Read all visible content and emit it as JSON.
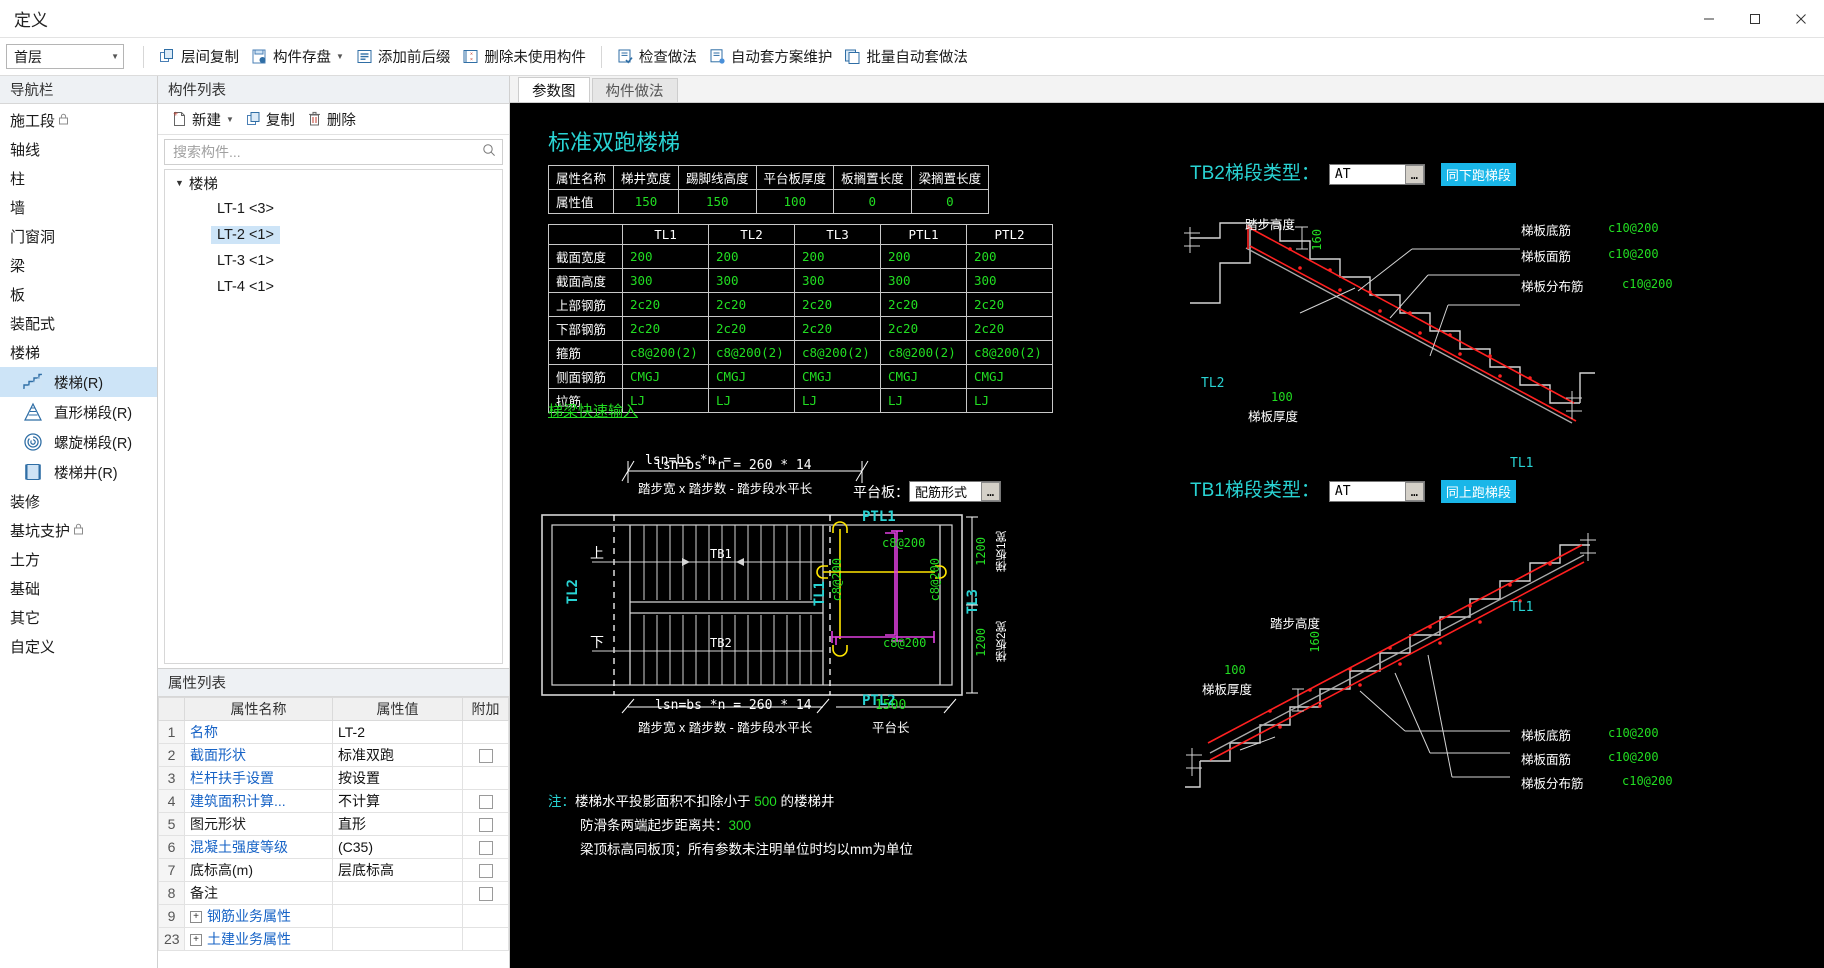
{
  "window": {
    "title": "定义",
    "minimize": "−",
    "maximize": "▢",
    "close": "✕"
  },
  "toolbar": {
    "floor_select": "首层",
    "buttons": [
      {
        "label": "层间复制",
        "icon": "copy-between-floors-icon",
        "dropdown": false
      },
      {
        "label": "构件存盘",
        "icon": "save-component-icon",
        "dropdown": true
      },
      {
        "label": "添加前后缀",
        "icon": "add-affix-icon",
        "dropdown": false
      },
      {
        "label": "删除未使用构件",
        "icon": "delete-unused-icon",
        "dropdown": false
      },
      {
        "label": "检查做法",
        "icon": "check-method-icon",
        "dropdown": false
      },
      {
        "label": "自动套方案维护",
        "icon": "auto-scheme-icon",
        "dropdown": false
      },
      {
        "label": "批量自动套做法",
        "icon": "batch-auto-icon",
        "dropdown": false
      }
    ]
  },
  "nav": {
    "title": "导航栏",
    "items": [
      {
        "label": "施工段",
        "locked": true
      },
      {
        "label": "轴线",
        "locked": false
      },
      {
        "label": "柱",
        "locked": false
      },
      {
        "label": "墙",
        "locked": false
      },
      {
        "label": "门窗洞",
        "locked": false
      },
      {
        "label": "梁",
        "locked": false
      },
      {
        "label": "板",
        "locked": false
      },
      {
        "label": "装配式",
        "locked": false
      },
      {
        "label": "楼梯",
        "locked": false
      }
    ],
    "sub_items": [
      {
        "label": "楼梯(R)",
        "icon": "stair-icon",
        "selected": true
      },
      {
        "label": "直形梯段(R)",
        "icon": "straight-flight-icon",
        "selected": false
      },
      {
        "label": "螺旋梯段(R)",
        "icon": "spiral-flight-icon",
        "selected": false
      },
      {
        "label": "楼梯井(R)",
        "icon": "stairwell-icon",
        "selected": false
      }
    ],
    "items_after": [
      {
        "label": "装修",
        "locked": false
      },
      {
        "label": "基坑支护",
        "locked": true
      },
      {
        "label": "土方",
        "locked": false
      },
      {
        "label": "基础",
        "locked": false
      },
      {
        "label": "其它",
        "locked": false
      },
      {
        "label": "自定义",
        "locked": false
      }
    ]
  },
  "component_panel": {
    "title": "构件列表",
    "tools": [
      {
        "label": "新建",
        "icon": "new-file-icon",
        "dropdown": true
      },
      {
        "label": "复制",
        "icon": "copy-icon",
        "dropdown": false
      },
      {
        "label": "删除",
        "icon": "trash-icon",
        "dropdown": false
      }
    ],
    "search_placeholder": "搜索构件...",
    "search_value": "",
    "tree_root": "楼梯",
    "tree_items": [
      {
        "label": "LT-1 <3>",
        "selected": false
      },
      {
        "label": "LT-2 <1>",
        "selected": true
      },
      {
        "label": "LT-3 <1>",
        "selected": false
      },
      {
        "label": "LT-4 <1>",
        "selected": false
      }
    ]
  },
  "properties": {
    "title": "属性列表",
    "columns": [
      "",
      "属性名称",
      "属性值",
      "附加"
    ],
    "rows": [
      {
        "idx": "1",
        "name": "名称",
        "value": "LT-2",
        "link": true,
        "checkbox": false,
        "expander": null
      },
      {
        "idx": "2",
        "name": "截面形状",
        "value": "标准双跑",
        "link": true,
        "checkbox": true,
        "expander": null
      },
      {
        "idx": "3",
        "name": "栏杆扶手设置",
        "value": "按设置",
        "link": true,
        "checkbox": false,
        "expander": null
      },
      {
        "idx": "4",
        "name": "建筑面积计算...",
        "value": "不计算",
        "link": true,
        "checkbox": true,
        "expander": null
      },
      {
        "idx": "5",
        "name": "图元形状",
        "value": "直形",
        "link": false,
        "checkbox": true,
        "expander": null
      },
      {
        "idx": "6",
        "name": "混凝土强度等级",
        "value": "(C35)",
        "link": true,
        "checkbox": true,
        "expander": null
      },
      {
        "idx": "7",
        "name": "底标高(m)",
        "value": "层底标高",
        "link": false,
        "checkbox": true,
        "expander": null
      },
      {
        "idx": "8",
        "name": "备注",
        "value": "",
        "link": false,
        "checkbox": true,
        "expander": null
      },
      {
        "idx": "9",
        "name": "钢筋业务属性",
        "value": "",
        "link": true,
        "checkbox": false,
        "expander": "+"
      },
      {
        "idx": "23",
        "name": "土建业务属性",
        "value": "",
        "link": true,
        "checkbox": false,
        "expander": "+"
      }
    ]
  },
  "main": {
    "tabs": [
      {
        "label": "参数图",
        "active": true
      },
      {
        "label": "构件做法",
        "active": false
      }
    ]
  },
  "diagram": {
    "title": "标准双跑楼梯",
    "quick_input_link": "梯梁快速输入",
    "table1": {
      "header_cell": "属性名称",
      "row_label": "属性值",
      "columns": [
        "梯井宽度",
        "踢脚线高度",
        "平台板厚度",
        "板搁置长度",
        "梁搁置长度"
      ],
      "values": [
        "150",
        "150",
        "100",
        "0",
        "0"
      ]
    },
    "table2": {
      "columns": [
        "TL1",
        "TL2",
        "TL3",
        "PTL1",
        "PTL2"
      ],
      "rows": [
        {
          "label": "截面宽度",
          "values": [
            "200",
            "200",
            "200",
            "200",
            "200"
          ]
        },
        {
          "label": "截面高度",
          "values": [
            "300",
            "300",
            "300",
            "300",
            "300"
          ]
        },
        {
          "label": "上部钢筋",
          "values": [
            "2c20",
            "2c20",
            "2c20",
            "2c20",
            "2c20"
          ]
        },
        {
          "label": "下部钢筋",
          "values": [
            "2c20",
            "2c20",
            "2c20",
            "2c20",
            "2c20"
          ]
        },
        {
          "label": "箍筋",
          "values": [
            "c8@200(2)",
            "c8@200(2)",
            "c8@200(2)",
            "c8@200(2)",
            "c8@200(2)"
          ]
        },
        {
          "label": "侧面钢筋",
          "values": [
            "CMGJ",
            "CMGJ",
            "CMGJ",
            "CMGJ",
            "CMGJ"
          ]
        },
        {
          "label": "拉筋",
          "values": [
            "LJ",
            "LJ",
            "LJ",
            "LJ",
            "LJ"
          ]
        }
      ]
    },
    "plan": {
      "top_dim_value": "lsn=bs *n = 260 * 14",
      "top_dim_caption": "踏步宽 x 踏步数 - 踏步段水平长",
      "bottom_dim_value": "lsn=bs *n = 260 * 14",
      "bottom_dim_caption": "踏步宽 x 踏步数 - 踏步段水平长",
      "platform_width": "1500",
      "platform_caption": "平台长",
      "slab_label": "平台板：",
      "slab_field": "配筋形式",
      "slab_ellipsis": "…",
      "up_label": "上",
      "down_label": "下",
      "flight_top": "TB1",
      "flight_bottom": "TB2",
      "beam_left": "TL2",
      "beam_mid": "TL1",
      "beam_right": "TL3",
      "beam_ptl1": "PTL1",
      "beam_ptl2": "PTL2",
      "rebar_top": "c8@200",
      "rebar_left": "c8@200",
      "rebar_right": "c8@200",
      "rebar_bottom": "c8@200",
      "dim_1200_a": "1200",
      "dim_1200_b": "1200",
      "side_label_a": "梯板1宽",
      "side_label_b": "梯板2宽"
    },
    "section_tb2": {
      "label": "TB2梯段类型：",
      "type_value": "AT",
      "ellipsis": "…",
      "badge": "同下跑梯段",
      "beam_label": "TL2",
      "end_beam_label": "TL1",
      "step_height_caption": "踏步高度",
      "step_height_value": "160",
      "slab_thickness_value": "100",
      "slab_thickness_caption": "梯板厚度",
      "callouts": [
        {
          "label": "梯板底筋",
          "value": "c10@200"
        },
        {
          "label": "梯板面筋",
          "value": "c10@200"
        },
        {
          "label": "梯板分布筋",
          "value": "c10@200"
        }
      ]
    },
    "section_tb1": {
      "label": "TB1梯段类型：",
      "type_value": "AT",
      "ellipsis": "…",
      "badge": "同上跑梯段",
      "end_beam_label": "TL1",
      "step_height_caption": "踏步高度",
      "step_height_value": "160",
      "slab_thickness_value": "100",
      "slab_thickness_caption": "梯板厚度",
      "callouts": [
        {
          "label": "梯板底筋",
          "value": "c10@200"
        },
        {
          "label": "梯板面筋",
          "value": "c10@200"
        },
        {
          "label": "梯板分布筋",
          "value": "c10@200"
        }
      ]
    },
    "notes": {
      "prefix": "注：",
      "line1_a": "楼梯水平投影面积不扣除小于 ",
      "line1_value": "500",
      "line1_b": " 的楼梯井",
      "line2_a": "防滑条两端起步距离共：",
      "line2_value": "300",
      "line3": "梁顶标高同板顶；所有参数未注明单位时均以mm为单位"
    }
  },
  "colors": {
    "cad_bg": "#000000",
    "cad_cyan": "#29d3d3",
    "cad_green": "#22dd22",
    "cad_white": "#ffffff",
    "cad_yellow": "#ffe600",
    "cad_magenta": "#e040e0",
    "cad_red": "#ff2020",
    "badge_blue": "#19b6e8",
    "selection_blue": "#cde4f7",
    "link_blue": "#1763c6"
  }
}
